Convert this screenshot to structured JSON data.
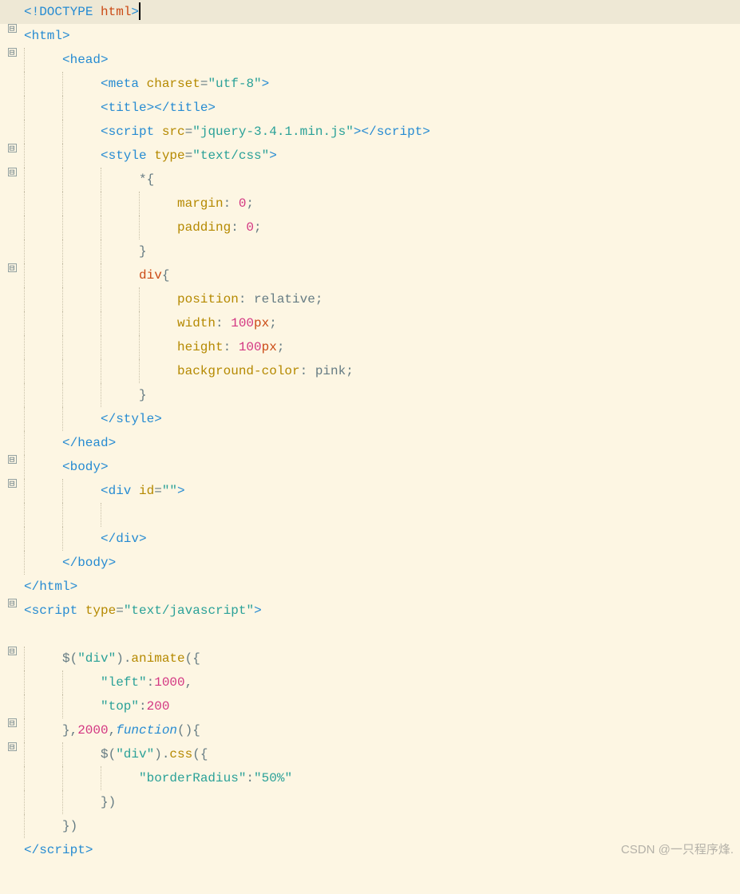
{
  "watermark": "CSDN @一只程序烽.",
  "fold_minus": "⊟",
  "code": {
    "l1_a": "<!DOCTYPE ",
    "l1_b": "html",
    "l1_c": ">",
    "l2_a": "<html>",
    "l3_a": "<head>",
    "l4_a": "<meta ",
    "l4_b": "charset",
    "l4_c": "=",
    "l4_d": "\"utf-8\"",
    "l4_e": ">",
    "l5_a": "<title></title>",
    "l6_a": "<script ",
    "l6_b": "src",
    "l6_c": "=",
    "l6_d": "\"jquery-3.4.1.min.js\"",
    "l6_e": "></",
    "l6_f": "script",
    "l6_g": ">",
    "l7_a": "<style ",
    "l7_b": "type",
    "l7_c": "=",
    "l7_d": "\"text/css\"",
    "l7_e": ">",
    "l8_a": "*{",
    "l9_a": "margin",
    "l9_b": ": ",
    "l9_c": "0",
    "l9_d": ";",
    "l10_a": "padding",
    "l10_b": ": ",
    "l10_c": "0",
    "l10_d": ";",
    "l11_a": "}",
    "l12_a": "div",
    "l12_b": "{",
    "l13_a": "position",
    "l13_b": ": ",
    "l13_c": "relative",
    "l13_d": ";",
    "l14_a": "width",
    "l14_b": ": ",
    "l14_c": "100",
    "l14_d": "px",
    "l14_e": ";",
    "l15_a": "height",
    "l15_b": ": ",
    "l15_c": "100",
    "l15_d": "px",
    "l15_e": ";",
    "l16_a": "background-color",
    "l16_b": ": ",
    "l16_c": "pink",
    "l16_d": ";",
    "l17_a": "}",
    "l18_a": "</style>",
    "l19_a": "</head>",
    "l20_a": "<body>",
    "l21_a": "<div ",
    "l21_b": "id",
    "l21_c": "=",
    "l21_d": "\"\"",
    "l21_e": ">",
    "l23_a": "</div>",
    "l24_a": "</body>",
    "l25_a": "</html>",
    "l26_a": "<script ",
    "l26_b": "type",
    "l26_c": "=",
    "l26_d": "\"text/javascript\"",
    "l26_e": ">",
    "l28_a": "$(",
    "l28_b": "\"div\"",
    "l28_c": ").",
    "l28_d": "animate",
    "l28_e": "({",
    "l29_a": "\"left\"",
    "l29_b": ":",
    "l29_c": "1000",
    "l29_d": ",",
    "l30_a": "\"top\"",
    "l30_b": ":",
    "l30_c": "200",
    "l31_a": "},",
    "l31_b": "2000",
    "l31_c": ",",
    "l31_d": "function",
    "l31_e": "(){",
    "l32_a": "$(",
    "l32_b": "\"div\"",
    "l32_c": ").",
    "l32_d": "css",
    "l32_e": "({",
    "l33_a": "\"borderRadius\"",
    "l33_b": ":",
    "l33_c": "\"50%\"",
    "l34_a": "})",
    "l35_a": "})",
    "l36_a": "</",
    "l36_b": "script",
    "l36_c": ">"
  }
}
